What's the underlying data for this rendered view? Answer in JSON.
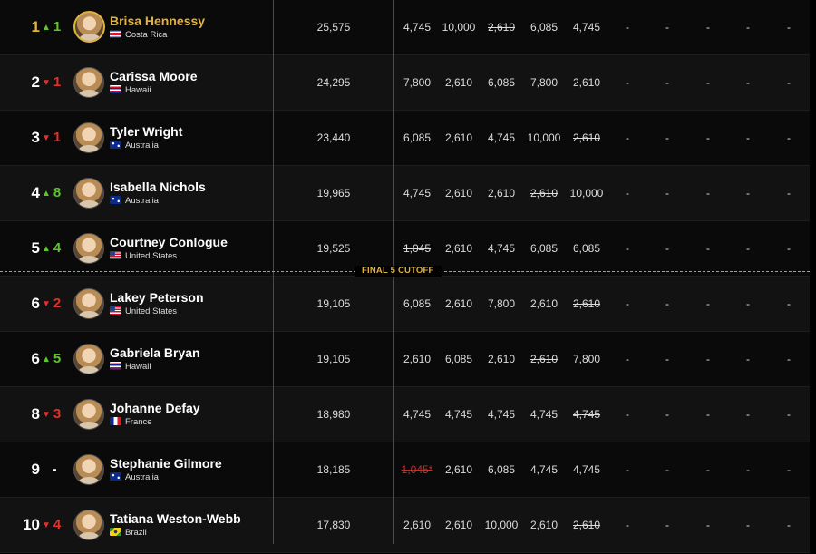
{
  "cutoff_label": "FINAL 5 CUTOFF",
  "colors": {
    "gold": "#e2b23a",
    "up": "#5fc52c",
    "down": "#e0322a"
  },
  "rows": [
    {
      "rank": "1",
      "dir": "up",
      "move": "1",
      "name": "Brisa Hennessy",
      "country": "Costa Rica",
      "flag": "costa-rica",
      "points": "25,575",
      "highlight": true,
      "events": [
        {
          "v": "4,745"
        },
        {
          "v": "10,000"
        },
        {
          "v": "2,610",
          "strike": true
        },
        {
          "v": "6,085"
        },
        {
          "v": "4,745"
        }
      ],
      "dashes": [
        "-",
        "-",
        "-",
        "-",
        "-"
      ]
    },
    {
      "rank": "2",
      "dir": "down",
      "move": "1",
      "name": "Carissa Moore",
      "country": "Hawaii",
      "flag": "hawaii",
      "points": "24,295",
      "events": [
        {
          "v": "7,800"
        },
        {
          "v": "2,610"
        },
        {
          "v": "6,085"
        },
        {
          "v": "7,800"
        },
        {
          "v": "2,610",
          "strike": true
        }
      ],
      "dashes": [
        "-",
        "-",
        "-",
        "-",
        "-"
      ]
    },
    {
      "rank": "3",
      "dir": "down",
      "move": "1",
      "name": "Tyler Wright",
      "country": "Australia",
      "flag": "australia",
      "points": "23,440",
      "events": [
        {
          "v": "6,085"
        },
        {
          "v": "2,610"
        },
        {
          "v": "4,745"
        },
        {
          "v": "10,000"
        },
        {
          "v": "2,610",
          "strike": true
        }
      ],
      "dashes": [
        "-",
        "-",
        "-",
        "-",
        "-"
      ]
    },
    {
      "rank": "4",
      "dir": "up",
      "move": "8",
      "name": "Isabella Nichols",
      "country": "Australia",
      "flag": "australia",
      "points": "19,965",
      "events": [
        {
          "v": "4,745"
        },
        {
          "v": "2,610"
        },
        {
          "v": "2,610"
        },
        {
          "v": "2,610",
          "strike": true
        },
        {
          "v": "10,000"
        }
      ],
      "dashes": [
        "-",
        "-",
        "-",
        "-",
        "-"
      ]
    },
    {
      "rank": "5",
      "dir": "up",
      "move": "4",
      "name": "Courtney Conlogue",
      "country": "United States",
      "flag": "usa",
      "points": "19,525",
      "events": [
        {
          "v": "1,045",
          "strike": true
        },
        {
          "v": "2,610"
        },
        {
          "v": "4,745"
        },
        {
          "v": "6,085"
        },
        {
          "v": "6,085"
        }
      ],
      "dashes": [
        "-",
        "-",
        "-",
        "-",
        "-"
      ]
    },
    {
      "rank": "6",
      "dir": "down",
      "move": "2",
      "name": "Lakey Peterson",
      "country": "United States",
      "flag": "usa",
      "points": "19,105",
      "events": [
        {
          "v": "6,085"
        },
        {
          "v": "2,610"
        },
        {
          "v": "7,800"
        },
        {
          "v": "2,610"
        },
        {
          "v": "2,610",
          "strike": true
        }
      ],
      "dashes": [
        "-",
        "-",
        "-",
        "-",
        "-"
      ]
    },
    {
      "rank": "6",
      "dir": "up",
      "move": "5",
      "name": "Gabriela Bryan",
      "country": "Hawaii",
      "flag": "hawaii",
      "points": "19,105",
      "events": [
        {
          "v": "2,610"
        },
        {
          "v": "6,085"
        },
        {
          "v": "2,610"
        },
        {
          "v": "2,610",
          "strike": true
        },
        {
          "v": "7,800"
        }
      ],
      "dashes": [
        "-",
        "-",
        "-",
        "-",
        "-"
      ]
    },
    {
      "rank": "8",
      "dir": "down",
      "move": "3",
      "name": "Johanne Defay",
      "country": "France",
      "flag": "france",
      "points": "18,980",
      "events": [
        {
          "v": "4,745"
        },
        {
          "v": "4,745"
        },
        {
          "v": "4,745"
        },
        {
          "v": "4,745"
        },
        {
          "v": "4,745",
          "strike": true
        }
      ],
      "dashes": [
        "-",
        "-",
        "-",
        "-",
        "-"
      ]
    },
    {
      "rank": "9",
      "dir": "none",
      "move": "-",
      "name": "Stephanie Gilmore",
      "country": "Australia",
      "flag": "australia",
      "points": "18,185",
      "events": [
        {
          "v": "1,045*",
          "red": true
        },
        {
          "v": "2,610"
        },
        {
          "v": "6,085"
        },
        {
          "v": "4,745"
        },
        {
          "v": "4,745"
        }
      ],
      "dashes": [
        "-",
        "-",
        "-",
        "-",
        "-"
      ]
    },
    {
      "rank": "10",
      "dir": "down",
      "move": "4",
      "name": "Tatiana Weston-Webb",
      "country": "Brazil",
      "flag": "brazil",
      "points": "17,830",
      "events": [
        {
          "v": "2,610"
        },
        {
          "v": "2,610"
        },
        {
          "v": "10,000"
        },
        {
          "v": "2,610"
        },
        {
          "v": "2,610",
          "strike": true
        }
      ],
      "dashes": [
        "-",
        "-",
        "-",
        "-",
        "-"
      ]
    }
  ]
}
